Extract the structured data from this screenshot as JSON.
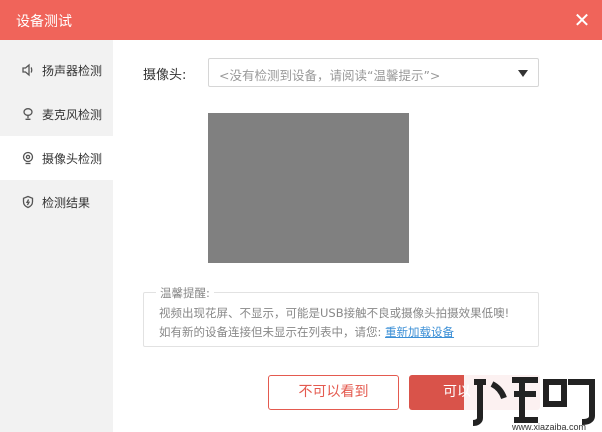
{
  "window": {
    "title": "设备测试",
    "close_icon": "close-icon"
  },
  "sidebar": {
    "items": [
      {
        "label": "扬声器检测",
        "icon": "speaker-icon",
        "active": false
      },
      {
        "label": "麦克风检测",
        "icon": "microphone-icon",
        "active": false
      },
      {
        "label": "摄像头检测",
        "icon": "camera-icon",
        "active": true
      },
      {
        "label": "检测结果",
        "icon": "shield-icon",
        "active": false
      }
    ]
  },
  "camera": {
    "label": "摄像头:",
    "selected": "<没有检测到设备，请阅读“温馨提示”>"
  },
  "tips": {
    "legend": "温馨提醒:",
    "line1": "视频出现花屏、不显示，可能是USB接触不良或摄像头拍摄效果低噢!",
    "line2_prefix": "如有新的设备连接但未显示在列表中，请您:",
    "reload_link": "重新加载设备"
  },
  "buttons": {
    "cant_see": "不可以看到",
    "can_see": "可以"
  },
  "watermark": {
    "brand": "下载吧",
    "url": "www.xiazaiba.com"
  },
  "colors": {
    "accent": "#f0645a",
    "primary_button": "#d9534a",
    "link": "#3b8fd6",
    "sidebar_bg": "#f2f2f2"
  }
}
